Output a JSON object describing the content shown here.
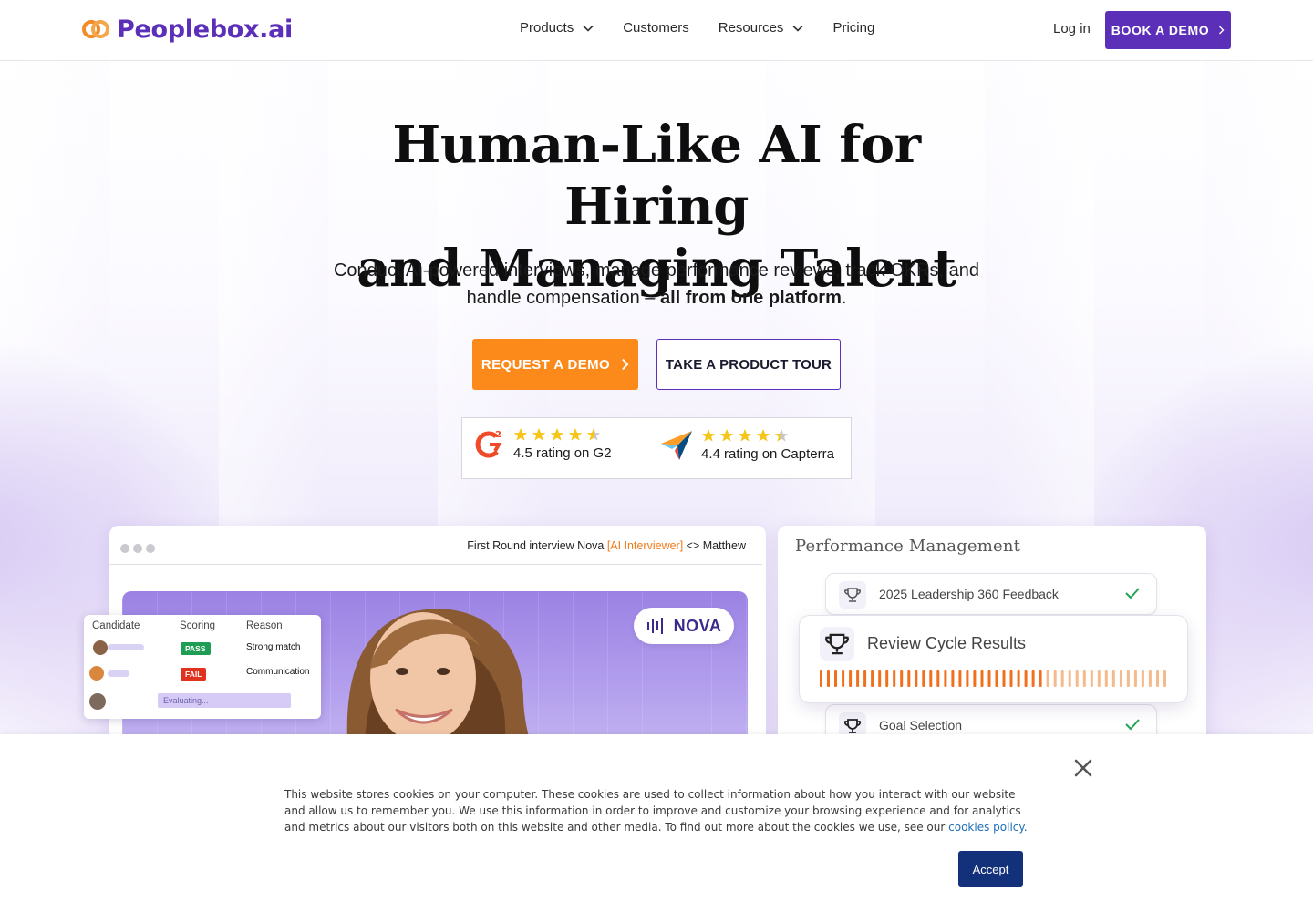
{
  "nav": {
    "brand": "Peoplebox.ai",
    "links": [
      {
        "label": "Products",
        "has_dropdown": true
      },
      {
        "label": "Customers",
        "has_dropdown": false
      },
      {
        "label": "Resources",
        "has_dropdown": true
      },
      {
        "label": "Pricing",
        "has_dropdown": false
      }
    ],
    "login": "Log in",
    "book_demo": "BOOK A DEMO"
  },
  "hero": {
    "headline_line1": "Human-Like AI for Hiring",
    "headline_line2": "and Managing Talent",
    "sub_line1": "Conduct AI-powered interviews, manage performance reviews, track OKRs, and",
    "sub_line2_prefix": "handle compensation –",
    "sub_line2_bold": "all from one platform",
    "sub_line2_suffix": ".",
    "cta_primary": "REQUEST A DEMO",
    "cta_secondary": "TAKE A PRODUCT TOUR"
  },
  "ratings": {
    "g2": {
      "text": "4.5 rating on G2",
      "stars": 4.5
    },
    "capterra": {
      "text": "4.4 rating on Capterra",
      "stars": 4.4
    }
  },
  "interview_card": {
    "title_prefix": "First Round interview  Nova ",
    "title_ai": "[AI Interviewer]",
    "title_suffix": " <> Matthew",
    "nova_label": "NOVA",
    "table": {
      "headers": [
        "Candidate",
        "Scoring",
        "Reason"
      ],
      "rows": [
        {
          "score": "PASS",
          "reason": "Strong match"
        },
        {
          "score": "FAIL",
          "reason": "Communication"
        }
      ],
      "evaluating": "Evaluating..."
    }
  },
  "performance_card": {
    "title": "Performance Management",
    "items": [
      {
        "label": "2025 Leadership 360 Feedback"
      },
      {
        "label": "Review Cycle Results"
      },
      {
        "label": "Goal Selection"
      }
    ],
    "review_progress": 0.65
  },
  "cookie": {
    "text": "This website stores cookies on your computer. These cookies are used to collect information about how you interact with our website and allow us to remember you. We use this information in order to improve and customize your browsing experience and for analytics and metrics about our visitors both on this website and other media. To find out more about the cookies we use, see our",
    "link": "cookies policy.",
    "accept": "Accept"
  },
  "colors": {
    "brand_purple": "#5b2fb8",
    "cta_orange": "#fb8a1b",
    "accept_navy": "#13307a",
    "star_yellow": "#f5c518"
  }
}
